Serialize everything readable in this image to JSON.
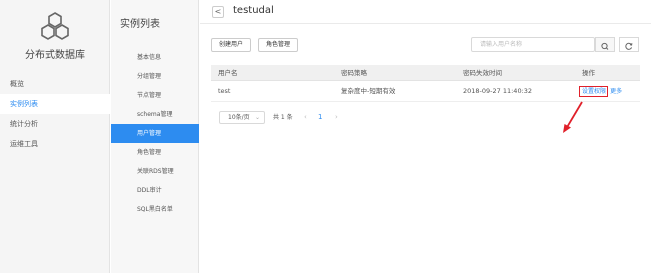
{
  "app": {
    "name": "分布式数据库"
  },
  "nav": {
    "items": [
      {
        "label": "概览",
        "active": false
      },
      {
        "label": "实例列表",
        "active": true
      },
      {
        "label": "统计分析",
        "active": false
      },
      {
        "label": "运维工具",
        "active": false
      }
    ]
  },
  "sub_nav": {
    "title": "实例列表",
    "items": [
      {
        "label": "基本信息",
        "active": false
      },
      {
        "label": "分组管理",
        "active": false
      },
      {
        "label": "节点管理",
        "active": false
      },
      {
        "label": "schema管理",
        "active": false
      },
      {
        "label": "用户管理",
        "active": true
      },
      {
        "label": "角色管理",
        "active": false
      },
      {
        "label": "关联RDS管理",
        "active": false
      },
      {
        "label": "DDL审计",
        "active": false
      },
      {
        "label": "SQL黑白名单",
        "active": false
      }
    ]
  },
  "header": {
    "back_label": "<",
    "title": "testudal"
  },
  "toolbar": {
    "create_user_label": "创建用户",
    "role_manage_label": "角色管理",
    "search_placeholder": "请输入用户名称",
    "search_icon": "search-icon",
    "refresh_icon": "refresh-icon"
  },
  "table": {
    "columns": [
      "用户名",
      "密码策略",
      "密码失效时间",
      "操作"
    ],
    "rows": [
      {
        "username": "test",
        "policy": "复杂度中-短期有效",
        "expire": "2018-09-27 11:40:32",
        "op_set_perm": "设置权限",
        "op_more": "更多"
      }
    ]
  },
  "pagination": {
    "page_size": "10条/页",
    "total": "共 1 条",
    "prev": "‹",
    "current": "1",
    "next": "›"
  },
  "colors": {
    "accent": "#2d8cf0",
    "highlight": "#e0202a"
  }
}
